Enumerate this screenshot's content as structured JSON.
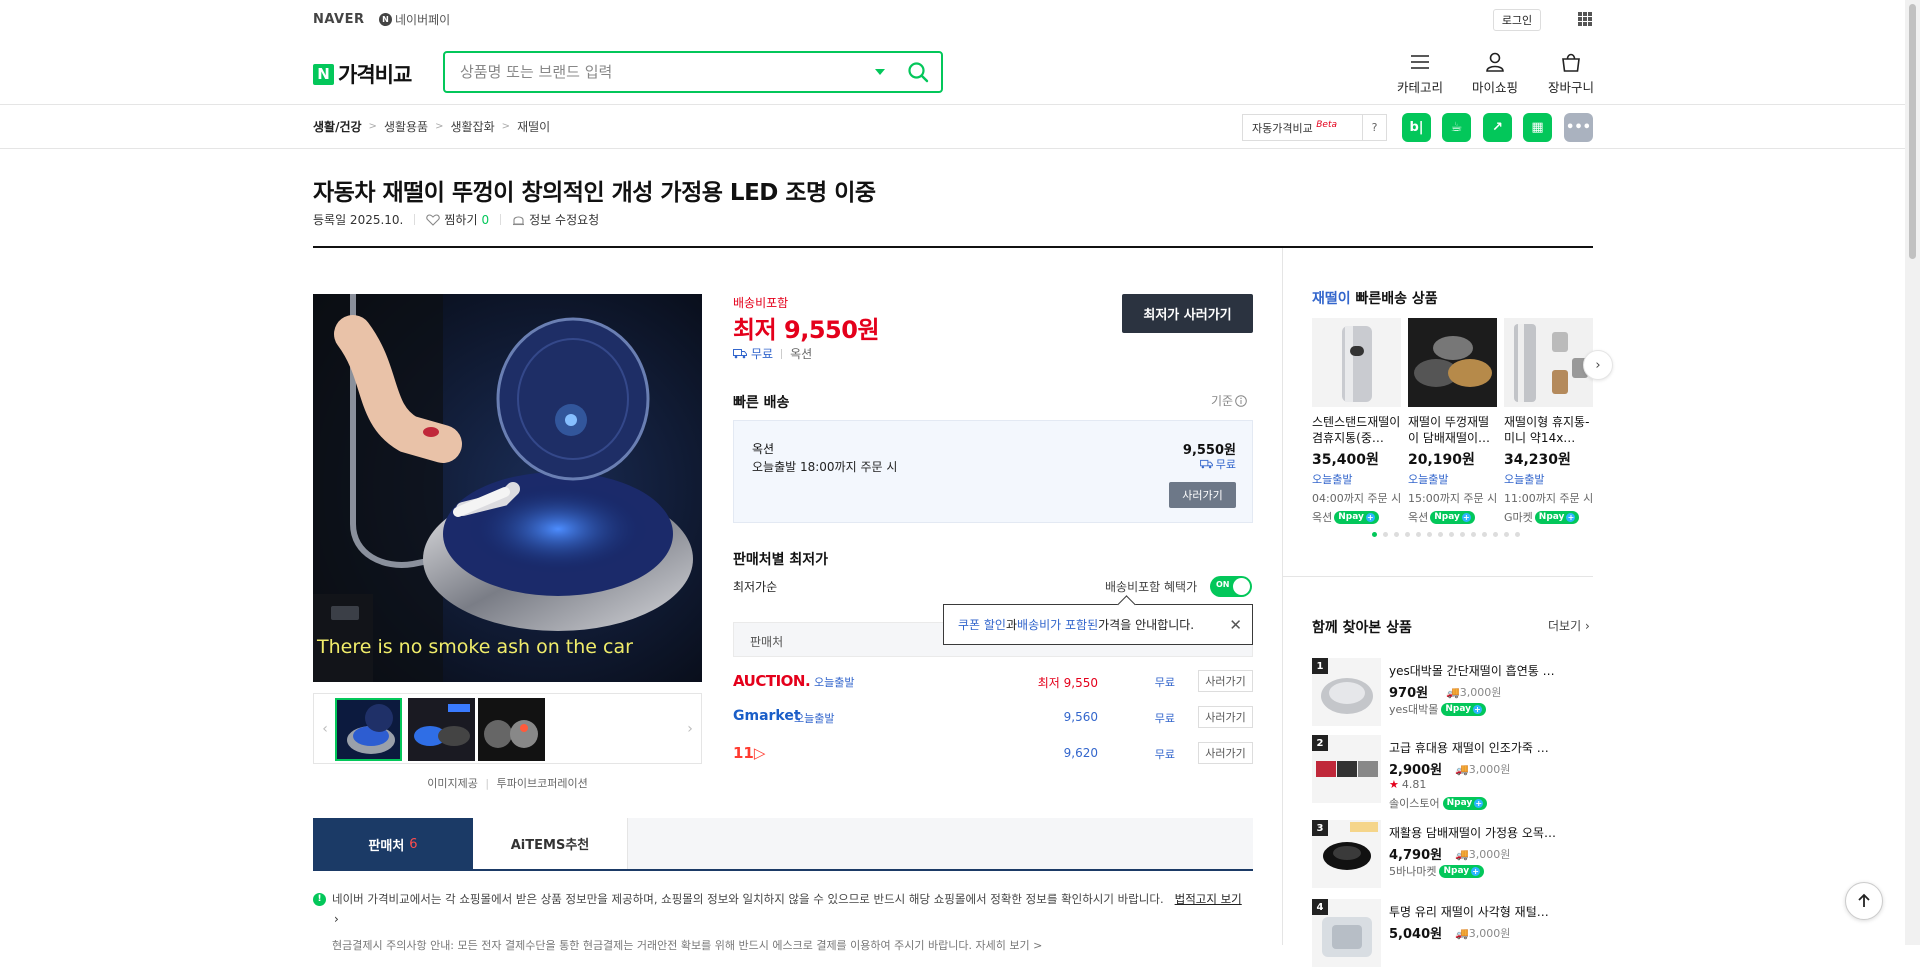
{
  "topbar": {
    "naver": "NAVER",
    "npay": "네이버페이",
    "npay_badge": "N",
    "login": "로그인"
  },
  "header": {
    "brand": "가격비교",
    "brand_badge": "N",
    "search_placeholder": "상품명 또는 브랜드 입력",
    "menu": [
      {
        "label": "카테고리",
        "icon": "menu-icon"
      },
      {
        "label": "마이쇼핑",
        "icon": "user-icon"
      },
      {
        "label": "장바구니",
        "icon": "cart-icon"
      }
    ]
  },
  "breadcrumb": [
    "생활/건강",
    "생활용품",
    "생활잡화",
    "재떨이"
  ],
  "auto_compare": {
    "label": "자동가격비교",
    "beta": "Beta",
    "help": "?"
  },
  "share_buttons": [
    {
      "name": "blog",
      "glyph": "b|",
      "color": "#03c75a"
    },
    {
      "name": "cafe",
      "glyph": "☕",
      "color": "#03c75a"
    },
    {
      "name": "band",
      "glyph": "↗",
      "color": "#03c75a"
    },
    {
      "name": "modoo",
      "glyph": "▦",
      "color": "#03c75a"
    },
    {
      "name": "more",
      "glyph": "•••",
      "color": "#aab2bf"
    }
  ],
  "product": {
    "title": "자동차 재떨이 뚜껑이 창의적인 개성 가정용 LED 조명 이중",
    "registered": "등록일 2025.10.",
    "wishlist": "찜하기",
    "wishlist_count": "0",
    "edit_request": "정보 수정요청",
    "image_caption": "There is no smoke ash on the car",
    "image_credit_1": "이미지제공",
    "image_credit_2": "투파이브코퍼레이션"
  },
  "price": {
    "shipping_included": "배송비포함",
    "lowest_label": "최저",
    "lowest_value": "9,550원",
    "free": "무료",
    "seller": "옥션",
    "buy_lowest": "최저가 사러가기"
  },
  "fast_delivery": {
    "heading": "빠른 배송",
    "basis": "기준",
    "seller": "옥션",
    "desc": "오늘출발 18:00까지 주문 시",
    "price": "9,550원",
    "ship": "무료",
    "buy": "사러가기"
  },
  "seller_prices": {
    "heading": "판매처별 최저가",
    "sort": "최저가순",
    "benefit_label": "배송비포함 혜택가",
    "toggle": "ON",
    "column_header": "판매처",
    "tooltip_pre": "쿠폰 할인",
    "tooltip_mid1": "과 ",
    "tooltip_mid2": "배송비가 포함된",
    "tooltip_post": " 가격을 안내합니다.",
    "rows": [
      {
        "mall": "AUCTION.",
        "color": "#e4001b",
        "tag": "오늘출발",
        "price": "최저 9,550",
        "free": "무료",
        "buy": "사러가기"
      },
      {
        "mall": "Gmarket",
        "color": "#1a5ec8",
        "tag": "오늘출발",
        "price": "9,560",
        "free": "무료",
        "buy": "사러가기"
      },
      {
        "mall": "11▷",
        "color": "#ff3b30",
        "tag": "",
        "price": "9,620",
        "free": "무료",
        "buy": "사러가기"
      }
    ]
  },
  "tabs": {
    "sellers": "판매처",
    "sellers_count": "6",
    "aitems": "AiTEMS추천"
  },
  "notice": {
    "text": "네이버 가격비교에서는 각 쇼핑몰에서 받은 상품 정보만을 제공하며, 쇼핑몰의 정보와 일치하지 않을 수 있으므로 반드시 해당 쇼핑몰에서 정확한 정보를 확인하시기 바랍니다.",
    "link": "법적고지 보기",
    "line2": "현금결제시 주의사항 안내: 모든 전자 결제수단을 통한 현금결제는 거래안전 확보를 위해 반드시 에스크로 결제를 이용하여 주시기 바랍니다.  자세히 보기 >"
  },
  "fast_products": {
    "keyword": "재떨이",
    "heading": " 빠른배송 상품",
    "items": [
      {
        "name": "스텐스탠드재떨이겸휴지통(중…",
        "price": "35,400원",
        "eta": "오늘출발",
        "cutoff": "04:00까지 주문 시",
        "mall": "옥션"
      },
      {
        "name": "재떨이 뚜껑재떨이 담배재떨이…",
        "price": "20,190원",
        "eta": "오늘출발",
        "cutoff": "15:00까지 주문 시",
        "mall": "옥션"
      },
      {
        "name": "재떨이형 휴지통-미니 약14x…",
        "price": "34,230원",
        "eta": "오늘출발",
        "cutoff": "11:00까지 주문 시",
        "mall": "G마켓"
      }
    ]
  },
  "together": {
    "heading": "함께 찾아본 상품",
    "more": "더보기",
    "items": [
      {
        "rank": "1",
        "name": "yes대박몰 간단재떨이 흡연통 …",
        "price": "970원",
        "ship": "3,000원",
        "mall": "yes대박몰",
        "rating": ""
      },
      {
        "rank": "2",
        "name": "고급 휴대용 재떨이 인조가죽 …",
        "price": "2,900원",
        "ship": "3,000원",
        "mall": "솔이스토어",
        "rating": "4.81"
      },
      {
        "rank": "3",
        "name": "재활용 담배재떨이 가정용 오목…",
        "price": "4,790원",
        "ship": "3,000원",
        "mall": "5바나마켓",
        "rating": ""
      },
      {
        "rank": "4",
        "name": "투명 유리 재떨이 사각형 재털…",
        "price": "5,040원",
        "ship": "3,000원",
        "mall": "",
        "rating": ""
      }
    ]
  },
  "npay": "pay"
}
